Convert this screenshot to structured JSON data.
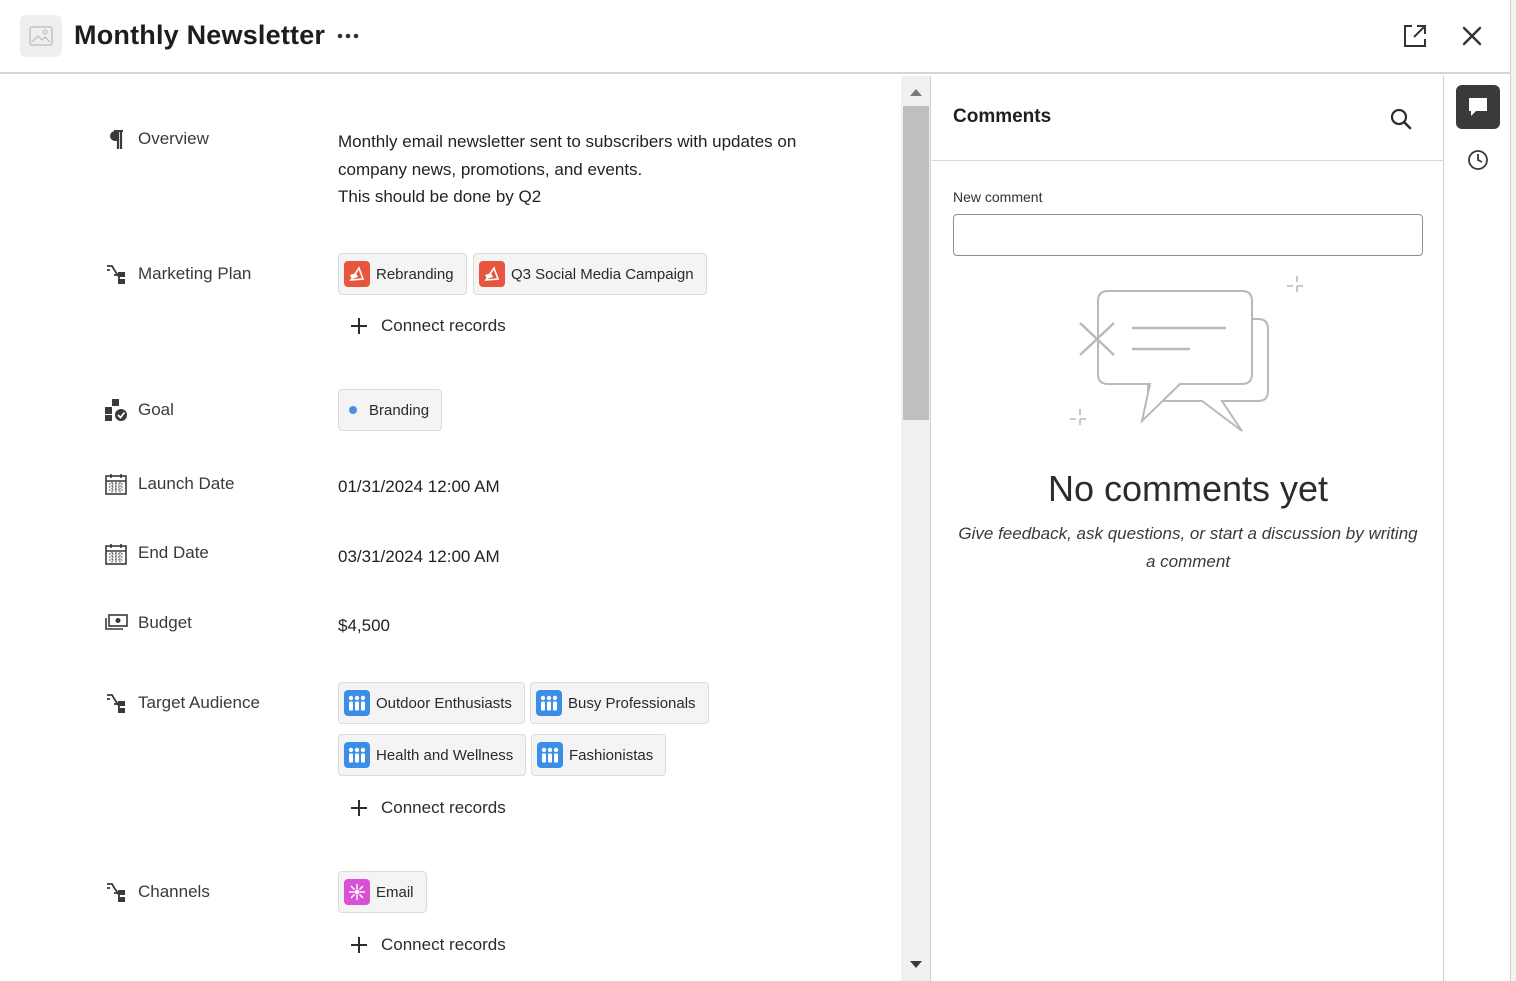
{
  "header": {
    "title": "Monthly Newsletter"
  },
  "fields": {
    "overview": {
      "label": "Overview",
      "lines": [
        "Monthly email newsletter sent to subscribers with updates on",
        "company news, promotions, and events.",
        "This should be done by Q2"
      ]
    },
    "marketing_plan": {
      "label": "Marketing Plan",
      "records": [
        "Rebranding",
        "Q3 Social Media Campaign"
      ],
      "connect_label": "Connect records"
    },
    "goal": {
      "label": "Goal",
      "tag": "Branding",
      "tag_color": "#4a90e2"
    },
    "launch_date": {
      "label": "Launch Date",
      "value": "01/31/2024 12:00 AM"
    },
    "end_date": {
      "label": "End Date",
      "value": "03/31/2024 12:00 AM"
    },
    "budget": {
      "label": "Budget",
      "value": "$4,500"
    },
    "target_audience": {
      "label": "Target Audience",
      "records": [
        "Outdoor Enthusiasts",
        "Busy Professionals",
        "Health and Wellness",
        "Fashionistas"
      ],
      "connect_label": "Connect records"
    },
    "channels": {
      "label": "Channels",
      "records": [
        "Email"
      ],
      "connect_label": "Connect records"
    }
  },
  "comments": {
    "title": "Comments",
    "input_label": "New comment",
    "input_value": "",
    "empty_title": "No comments yet",
    "empty_description": "Give feedback, ask questions, or start a discussion by writing a comment"
  },
  "colors": {
    "plan_icon": "#e8553f",
    "audience_icon": "#3b8ee8",
    "channel_icon": "#d94fd6",
    "rail_active": "#3a3a3a"
  },
  "icons": {
    "header": [
      "image-placeholder-icon",
      "more-icon",
      "open-in-new-icon",
      "close-icon"
    ],
    "rail": [
      "comments-icon",
      "history-icon"
    ]
  }
}
